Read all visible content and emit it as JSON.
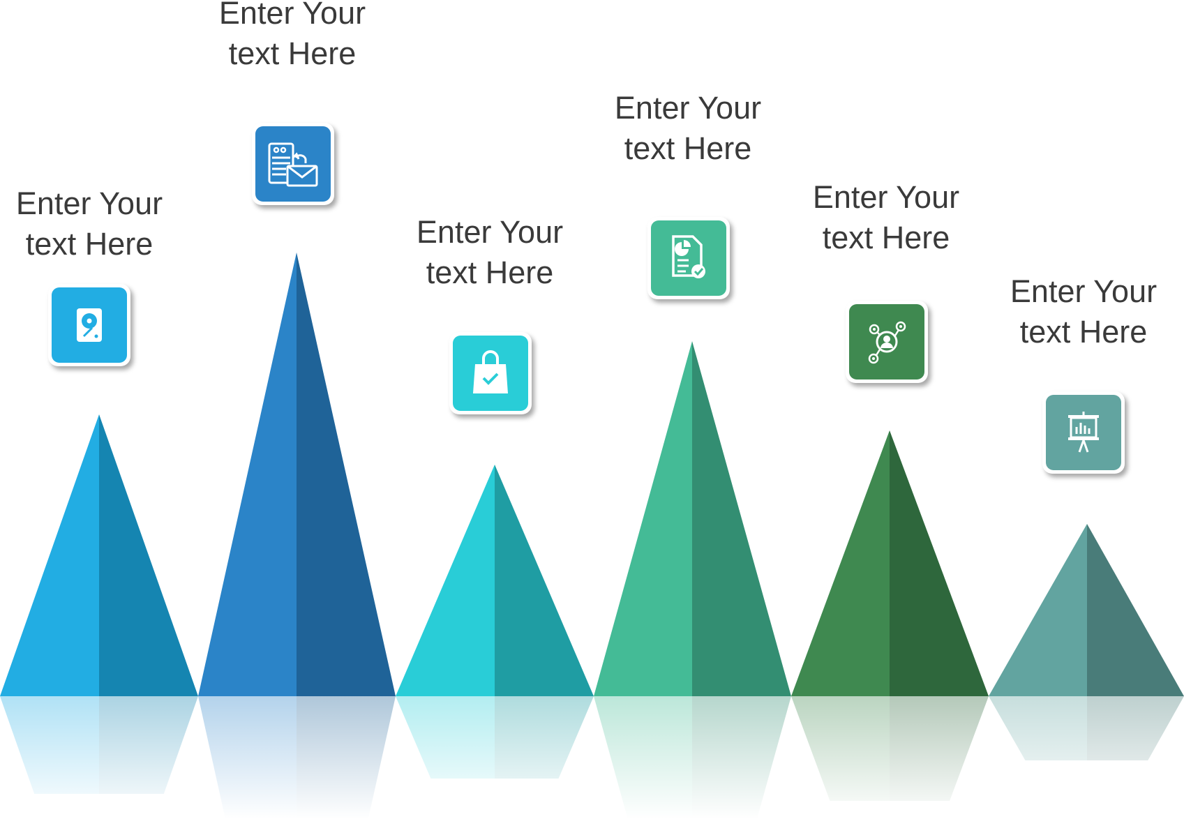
{
  "items": [
    {
      "line1": "Enter Your",
      "line2": "text Here",
      "icon": "hard-drive-icon",
      "color": "#22ADE3",
      "color_dark": "#1585B1"
    },
    {
      "line1": "Enter Your",
      "line2": "text Here",
      "icon": "server-mail-icon",
      "color": "#2B84C8",
      "color_dark": "#1F6398"
    },
    {
      "line1": "Enter Your",
      "line2": "text Here",
      "icon": "shopping-bag-check-icon",
      "color": "#29CDD7",
      "color_dark": "#1F9DA3"
    },
    {
      "line1": "Enter Your",
      "line2": "text Here",
      "icon": "report-document-icon",
      "color": "#44BB96",
      "color_dark": "#338E72"
    },
    {
      "line1": "Enter Your",
      "line2": "text Here",
      "icon": "social-network-icon",
      "color": "#3F8950",
      "color_dark": "#2E673C"
    },
    {
      "line1": "Enter Your",
      "line2": "text Here",
      "icon": "presentation-board-icon",
      "color": "#62A4A0",
      "color_dark": "#497C79"
    }
  ]
}
